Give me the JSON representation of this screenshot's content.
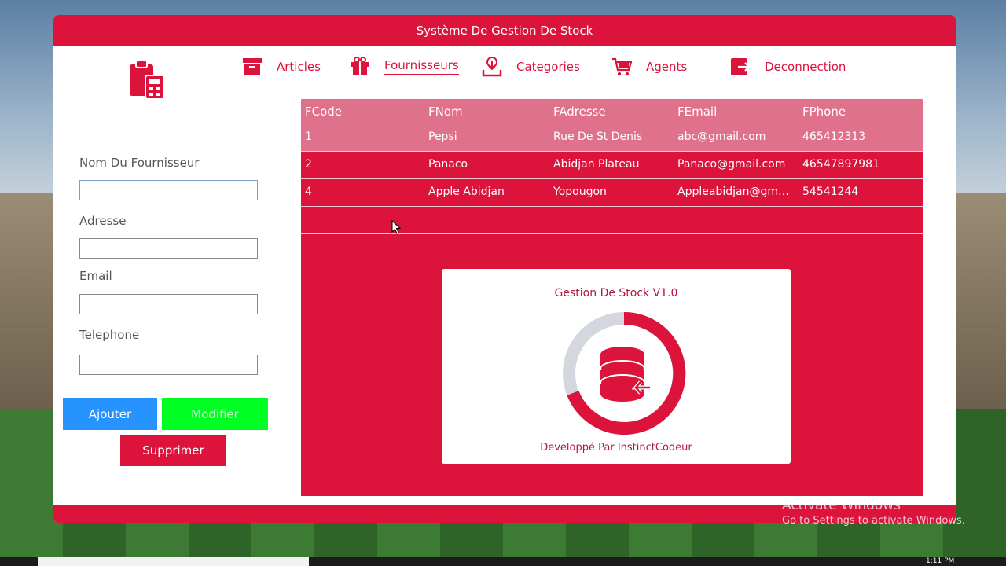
{
  "window": {
    "title": "Système De Gestion De Stock"
  },
  "nav": [
    {
      "label": "Articles",
      "icon": "box-icon"
    },
    {
      "label": "Fournisseurs",
      "icon": "gift-icon",
      "active": true
    },
    {
      "label": "Categories",
      "icon": "download-tray-icon"
    },
    {
      "label": "Agents",
      "icon": "cart-icon"
    },
    {
      "label": "Deconnection",
      "icon": "logout-icon"
    }
  ],
  "form": {
    "name_label": "Nom Du Fournisseur",
    "address_label": "Adresse",
    "email_label": "Email",
    "phone_label": "Telephone",
    "name_value": "",
    "address_value": "",
    "email_value": "",
    "phone_value": ""
  },
  "buttons": {
    "add": "Ajouter",
    "edit": "Modifier",
    "delete": "Supprimer"
  },
  "grid": {
    "columns": [
      "FCode",
      "FNom",
      "FAdresse",
      "FEmail",
      "FPhone"
    ],
    "rows": [
      [
        "1",
        "Pepsi",
        "Rue De St Denis",
        "abc@gmail.com",
        "465412313"
      ],
      [
        "2",
        "Panaco",
        "Abidjan Plateau",
        "Panaco@gmail.com",
        "46547897981"
      ],
      [
        "4",
        "Apple Abidjan",
        "Yopougon",
        "Appleabidjan@gmail.com",
        "54541244"
      ]
    ],
    "selected_row": 0
  },
  "splash": {
    "title": "Gestion De Stock V1.0",
    "credit": "Developpé Par InstinctCodeur"
  },
  "watermark": {
    "line1": "Activate Windows",
    "line2": "Go to Settings to activate Windows."
  },
  "taskbar": {
    "clock": "1:11 PM"
  },
  "colors": {
    "primary": "#dc143c",
    "row_selected": "#e0718c",
    "add": "#2693ff",
    "edit": "#00ff22"
  }
}
